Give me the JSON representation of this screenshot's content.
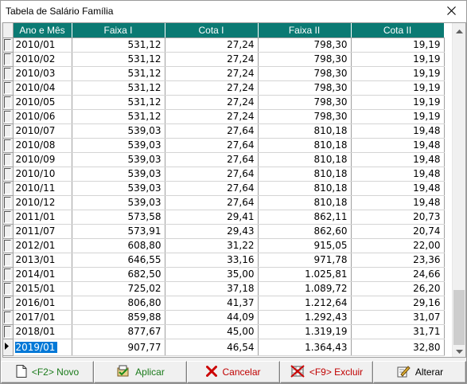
{
  "window": {
    "title": "Tabela de Salário Família",
    "close_glyph": "✕"
  },
  "grid": {
    "columns": [
      "Ano e Mês",
      "Faixa I",
      "Cota I",
      "Faixa II",
      "Cota II"
    ],
    "rows": [
      [
        "2010/01",
        "531,12",
        "27,24",
        "798,30",
        "19,19"
      ],
      [
        "2010/02",
        "531,12",
        "27,24",
        "798,30",
        "19,19"
      ],
      [
        "2010/03",
        "531,12",
        "27,24",
        "798,30",
        "19,19"
      ],
      [
        "2010/04",
        "531,12",
        "27,24",
        "798,30",
        "19,19"
      ],
      [
        "2010/05",
        "531,12",
        "27,24",
        "798,30",
        "19,19"
      ],
      [
        "2010/06",
        "531,12",
        "27,24",
        "798,30",
        "19,19"
      ],
      [
        "2010/07",
        "539,03",
        "27,64",
        "810,18",
        "19,48"
      ],
      [
        "2010/08",
        "539,03",
        "27,64",
        "810,18",
        "19,48"
      ],
      [
        "2010/09",
        "539,03",
        "27,64",
        "810,18",
        "19,48"
      ],
      [
        "2010/10",
        "539,03",
        "27,64",
        "810,18",
        "19,48"
      ],
      [
        "2010/11",
        "539,03",
        "27,64",
        "810,18",
        "19,48"
      ],
      [
        "2010/12",
        "539,03",
        "27,64",
        "810,18",
        "19,48"
      ],
      [
        "2011/01",
        "573,58",
        "29,41",
        "862,11",
        "20,73"
      ],
      [
        "2011/07",
        "573,91",
        "29,43",
        "862,60",
        "20,74"
      ],
      [
        "2012/01",
        "608,80",
        "31,22",
        "915,05",
        "22,00"
      ],
      [
        "2013/01",
        "646,55",
        "33,16",
        "971,78",
        "23,36"
      ],
      [
        "2014/01",
        "682,50",
        "35,00",
        "1.025,81",
        "24,66"
      ],
      [
        "2015/01",
        "725,02",
        "37,18",
        "1.089,72",
        "26,20"
      ],
      [
        "2016/01",
        "806,80",
        "41,37",
        "1.212,64",
        "29,16"
      ],
      [
        "2017/01",
        "859,88",
        "44,09",
        "1.292,43",
        "31,07"
      ],
      [
        "2018/01",
        "877,67",
        "45,00",
        "1.319,19",
        "31,71"
      ],
      [
        "2019/01",
        "907,77",
        "46,54",
        "1.364,43",
        "32,80"
      ]
    ],
    "selected_row": 21,
    "header_color": "#0b7a73",
    "selection_color": "#0078d7"
  },
  "buttons": {
    "novo": {
      "label": "<F2> Novo",
      "icon": "new-document-icon"
    },
    "aplicar": {
      "label": "Aplicar",
      "icon": "apply-icon"
    },
    "cancelar": {
      "label": "Cancelar",
      "icon": "cancel-x-icon"
    },
    "excluir": {
      "label": "<F9> Excluir",
      "icon": "delete-icon"
    },
    "alterar": {
      "label": "Alterar",
      "icon": "edit-icon"
    }
  }
}
